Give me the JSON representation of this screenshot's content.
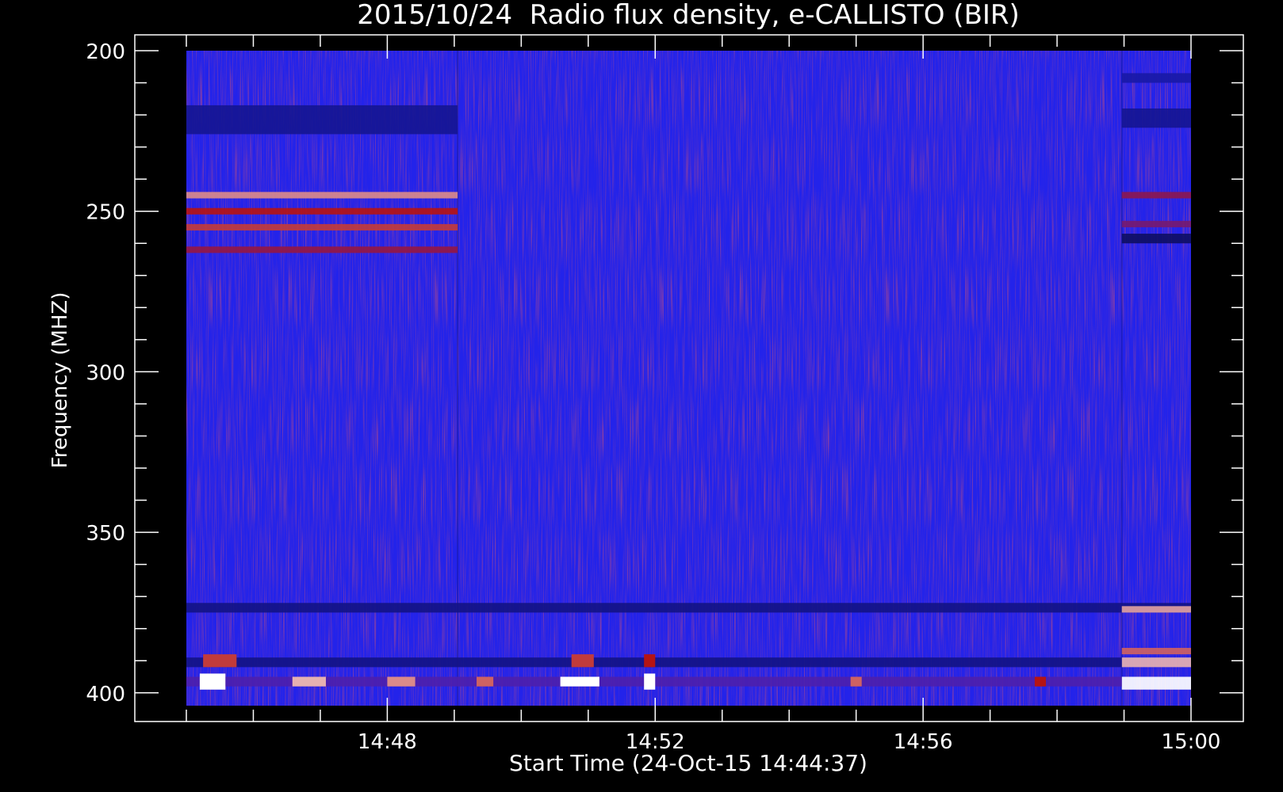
{
  "chart_data": {
    "type": "heatmap",
    "title": "2015/10/24  Radio flux density, e-CALLISTO (BIR)",
    "xlabel": "Start Time (24-Oct-15 14:44:37)",
    "ylabel": "Frequency (MHZ)",
    "x_ticks": [
      "14:48",
      "14:52",
      "14:56",
      "15:00"
    ],
    "y_ticks": [
      200,
      250,
      300,
      350,
      400
    ],
    "x_range": [
      "14:44:37",
      "15:00:00"
    ],
    "xlim": [
      "14:45:00",
      "15:00:00"
    ],
    "ylim": [
      200,
      404
    ],
    "y_axis_inverted": true,
    "colormap": {
      "low": "#000000",
      "base": "#2323ea",
      "mid": "#b51414",
      "high": "#ffffff"
    },
    "intensity_scale": "relative 0-1",
    "segments": [
      {
        "start": "14:45:00",
        "end": "14:49:03"
      },
      {
        "start": "14:49:03",
        "end": "14:58:58"
      },
      {
        "start": "14:58:58",
        "end": "15:00:00"
      }
    ],
    "bands": [
      {
        "freq_from": 217,
        "freq_to": 226,
        "time_from": "14:45:00",
        "time_to": "14:49:03",
        "intensity": 0.22
      },
      {
        "freq_from": 244,
        "freq_to": 246,
        "time_from": "14:45:00",
        "time_to": "14:49:03",
        "intensity": 0.85
      },
      {
        "freq_from": 249,
        "freq_to": 251,
        "time_from": "14:45:00",
        "time_to": "14:49:03",
        "intensity": 0.7
      },
      {
        "freq_from": 254,
        "freq_to": 256,
        "time_from": "14:45:00",
        "time_to": "14:49:03",
        "intensity": 0.75
      },
      {
        "freq_from": 261,
        "freq_to": 263,
        "time_from": "14:45:00",
        "time_to": "14:49:03",
        "intensity": 0.62
      },
      {
        "freq_from": 207,
        "freq_to": 210,
        "time_from": "14:58:58",
        "time_to": "15:00:00",
        "intensity": 0.25
      },
      {
        "freq_from": 218,
        "freq_to": 224,
        "time_from": "14:58:58",
        "time_to": "15:00:00",
        "intensity": 0.22
      },
      {
        "freq_from": 244,
        "freq_to": 246,
        "time_from": "14:58:58",
        "time_to": "15:00:00",
        "intensity": 0.6
      },
      {
        "freq_from": 253,
        "freq_to": 255,
        "time_from": "14:58:58",
        "time_to": "15:00:00",
        "intensity": 0.55
      },
      {
        "freq_from": 257,
        "freq_to": 260,
        "time_from": "14:58:58",
        "time_to": "15:00:00",
        "intensity": 0.15
      },
      {
        "freq_from": 372,
        "freq_to": 375,
        "time_from": "14:45:00",
        "time_to": "15:00:00",
        "intensity": 0.2
      },
      {
        "freq_from": 373,
        "freq_to": 375,
        "time_from": "14:58:58",
        "time_to": "15:00:00",
        "intensity": 0.88
      },
      {
        "freq_from": 386,
        "freq_to": 388,
        "time_from": "14:58:58",
        "time_to": "15:00:00",
        "intensity": 0.8
      },
      {
        "freq_from": 389,
        "freq_to": 392,
        "time_from": "14:58:58",
        "time_to": "15:00:00",
        "intensity": 0.9
      },
      {
        "freq_from": 395,
        "freq_to": 399,
        "time_from": "14:58:58",
        "time_to": "15:00:00",
        "intensity": 1.0
      },
      {
        "freq_from": 389,
        "freq_to": 392,
        "time_from": "14:45:00",
        "time_to": "14:58:58",
        "intensity": 0.2
      },
      {
        "freq_from": 395,
        "freq_to": 398,
        "time_from": "14:45:00",
        "time_to": "14:58:58",
        "intensity": 0.45
      }
    ],
    "bursts": [
      {
        "freq_from": 394,
        "freq_to": 399,
        "time_from": "14:45:12",
        "time_to": "14:45:35",
        "intensity": 1.0
      },
      {
        "freq_from": 388,
        "freq_to": 392,
        "time_from": "14:45:15",
        "time_to": "14:45:45",
        "intensity": 0.75
      },
      {
        "freq_from": 395,
        "freq_to": 398,
        "time_from": "14:46:35",
        "time_to": "14:47:05",
        "intensity": 0.9
      },
      {
        "freq_from": 395,
        "freq_to": 398,
        "time_from": "14:48:00",
        "time_to": "14:48:25",
        "intensity": 0.85
      },
      {
        "freq_from": 395,
        "freq_to": 398,
        "time_from": "14:49:20",
        "time_to": "14:49:35",
        "intensity": 0.8
      },
      {
        "freq_from": 395,
        "freq_to": 398,
        "time_from": "14:50:35",
        "time_to": "14:51:10",
        "intensity": 1.0
      },
      {
        "freq_from": 388,
        "freq_to": 392,
        "time_from": "14:50:45",
        "time_to": "14:51:05",
        "intensity": 0.75
      },
      {
        "freq_from": 394,
        "freq_to": 399,
        "time_from": "14:51:50",
        "time_to": "14:52:00",
        "intensity": 1.0
      },
      {
        "freq_from": 388,
        "freq_to": 392,
        "time_from": "14:51:50",
        "time_to": "14:52:00",
        "intensity": 0.7
      },
      {
        "freq_from": 395,
        "freq_to": 398,
        "time_from": "14:54:55",
        "time_to": "14:55:05",
        "intensity": 0.8
      },
      {
        "freq_from": 395,
        "freq_to": 398,
        "time_from": "14:57:40",
        "time_to": "14:57:50",
        "intensity": 0.7
      }
    ]
  }
}
